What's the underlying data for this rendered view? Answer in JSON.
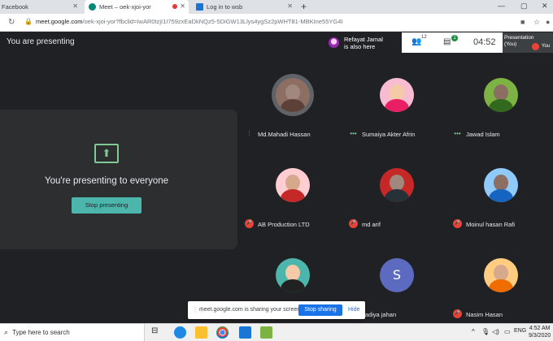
{
  "browser": {
    "tabs": [
      {
        "label": "Facebook"
      },
      {
        "label": "Meet – oek-xjoi-yor"
      },
      {
        "label": "Log in to wsb"
      }
    ],
    "new_tab": "+",
    "url_host": "meet.google.com",
    "url_rest": "/oek-xjoi-yor?fbclid=IwAR0tzjI1I759zxEaDkNQz5-5DiGW13Llys4ygSz2pWHT81-MBKIne55YG4I"
  },
  "meet": {
    "presenting_label": "You are presenting",
    "also_here_name": "Refayat Jamal",
    "also_here_suffix": "is also here",
    "people_count": "12",
    "chat_badge": "1",
    "clock": "04:52",
    "self_tile_line1": "Presentation",
    "self_tile_line2": "(You)",
    "self_tile_you": "You",
    "present_text": "You're presenting to everyone",
    "stop_presenting": "Stop presenting"
  },
  "participants": [
    {
      "name": "Md.Mahadi Hassan",
      "status": "speaking",
      "avatar_color": "#5d4037"
    },
    {
      "name": "Sumaiya Akter Afrin",
      "status": "dots",
      "avatar_color": "#e91e63"
    },
    {
      "name": "Jawad Islam",
      "status": "dots",
      "avatar_color": "#33691e"
    },
    {
      "name": "AB Production LTD",
      "status": "muted",
      "avatar_color": "#c62828"
    },
    {
      "name": "md arif",
      "status": "muted",
      "avatar_color": "#263238"
    },
    {
      "name": "Moinul hasan Rafi",
      "status": "muted",
      "avatar_color": "#1565c0"
    },
    {
      "name": "",
      "status": "none",
      "avatar_color": "#00897b"
    },
    {
      "name": "sadiya jahan",
      "status": "muted",
      "avatar_letter": "S",
      "avatar_color": "#5c6bc0"
    },
    {
      "name": "Nasim Hasan",
      "status": "muted",
      "avatar_color": "#ef6c00"
    }
  ],
  "share_banner": {
    "message": "meet.google.com is sharing your screen.",
    "stop_sharing": "Stop sharing",
    "hide": "Hide"
  },
  "taskbar": {
    "search_placeholder": "Type here to search",
    "lang": "ENG",
    "time": "4:52 AM",
    "date": "9/3/2020"
  },
  "colors": {
    "accent_teal": "#4db6ac",
    "mute_red": "#ea4335",
    "stop_sharing_blue": "#1a73e8",
    "meet_bg": "#202124"
  }
}
